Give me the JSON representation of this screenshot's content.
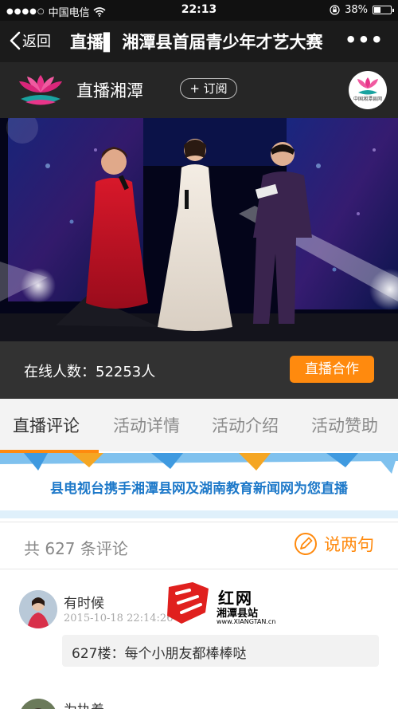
{
  "status_bar": {
    "carrier": "中国电信",
    "time": "22:13",
    "battery": "38%",
    "battery_level": 0.38
  },
  "nav": {
    "back_label": "返回",
    "title": "直播▌ 湘潭县首届青少年才艺大赛",
    "more": "•••"
  },
  "channel": {
    "name": "直播湘潭",
    "subscribe_label": "+ 订阅",
    "badge_text": "中国湘潭县网"
  },
  "info": {
    "online_label": "在线人数：52253人",
    "coop_label": "直播合作"
  },
  "tabs": [
    {
      "label": "直播评论"
    },
    {
      "label": "活动详情"
    },
    {
      "label": "活动介绍"
    },
    {
      "label": "活动赞助"
    }
  ],
  "banner": {
    "text": "县电视台携手湘潭县网及湖南教育新闻网为您直播"
  },
  "comments_header": {
    "count_label": "共 627 条评论",
    "say_label": "说两句"
  },
  "comments": [
    {
      "user": "有时候",
      "time": "2015-10-18 22:14:26",
      "text": "627楼：每个小朋友都棒棒哒"
    },
    {
      "user": "为执着"
    }
  ],
  "watermark": {
    "title": "红网",
    "subtitle": "湘潭县站",
    "url": "www.XIANGTAN.cn"
  },
  "colors": {
    "accent": "#ff8a0e",
    "banner_blue": "#1e79c9",
    "nav_bg": "#1b1b1b",
    "info_bg": "#323232"
  }
}
